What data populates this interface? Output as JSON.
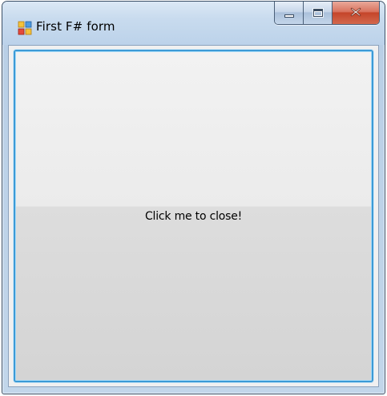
{
  "window": {
    "title": "First F# form",
    "icon": "winforms-app-icon",
    "caption_buttons": [
      {
        "name": "minimize",
        "icon": "minimize-icon"
      },
      {
        "name": "maximize",
        "icon": "maximize-icon"
      },
      {
        "name": "close",
        "icon": "close-icon"
      }
    ]
  },
  "main": {
    "button_label": "Click me to close!"
  },
  "colors": {
    "focus_border": "#3c9ad6",
    "close_button": "#c4452a",
    "client_background": "#f0f0f0"
  }
}
